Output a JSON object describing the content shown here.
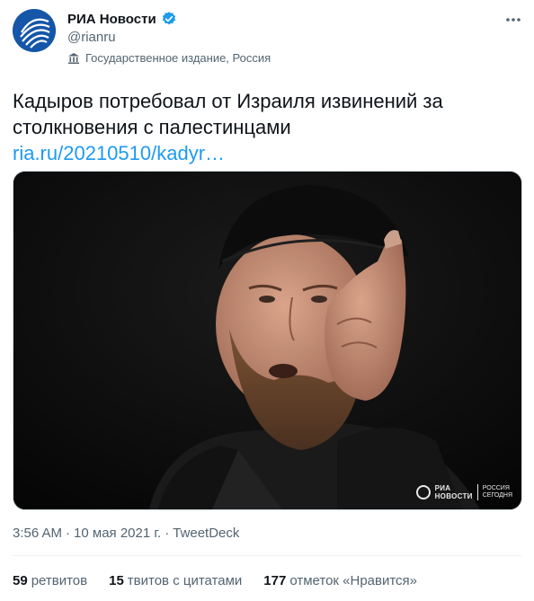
{
  "account": {
    "name": "РИА Новости",
    "handle": "@rianru",
    "label": "Государственное издание, Россия",
    "avatar_icon": "ria-logo-icon",
    "avatar_color": "#1556a8",
    "verified_icon": "verified-badge-icon",
    "verified_color": "#1d9bf0"
  },
  "tweet": {
    "text_line1": "Кадыров потребовал от Израиля извинений за",
    "text_line2": "столкновения с палестинцами",
    "link": "ria.ru/20210510/kadyr…",
    "link_color": "#1d9bf0"
  },
  "media": {
    "watermark_brand": "РИА",
    "watermark_brand2": "НОВОСТИ",
    "watermark_sub1": "РОССИЯ",
    "watermark_sub2": "СЕГОДНЯ"
  },
  "meta": {
    "time": "3:56 AM",
    "sep": "·",
    "date": "10 мая 2021 г.",
    "sep2": "·",
    "source": "TweetDeck"
  },
  "stats": {
    "retweets_count": "59",
    "retweets_label": "ретвитов",
    "quotes_count": "15",
    "quotes_label": "твитов с цитатами",
    "likes_count": "177",
    "likes_label": "отметок «Нравится»"
  }
}
